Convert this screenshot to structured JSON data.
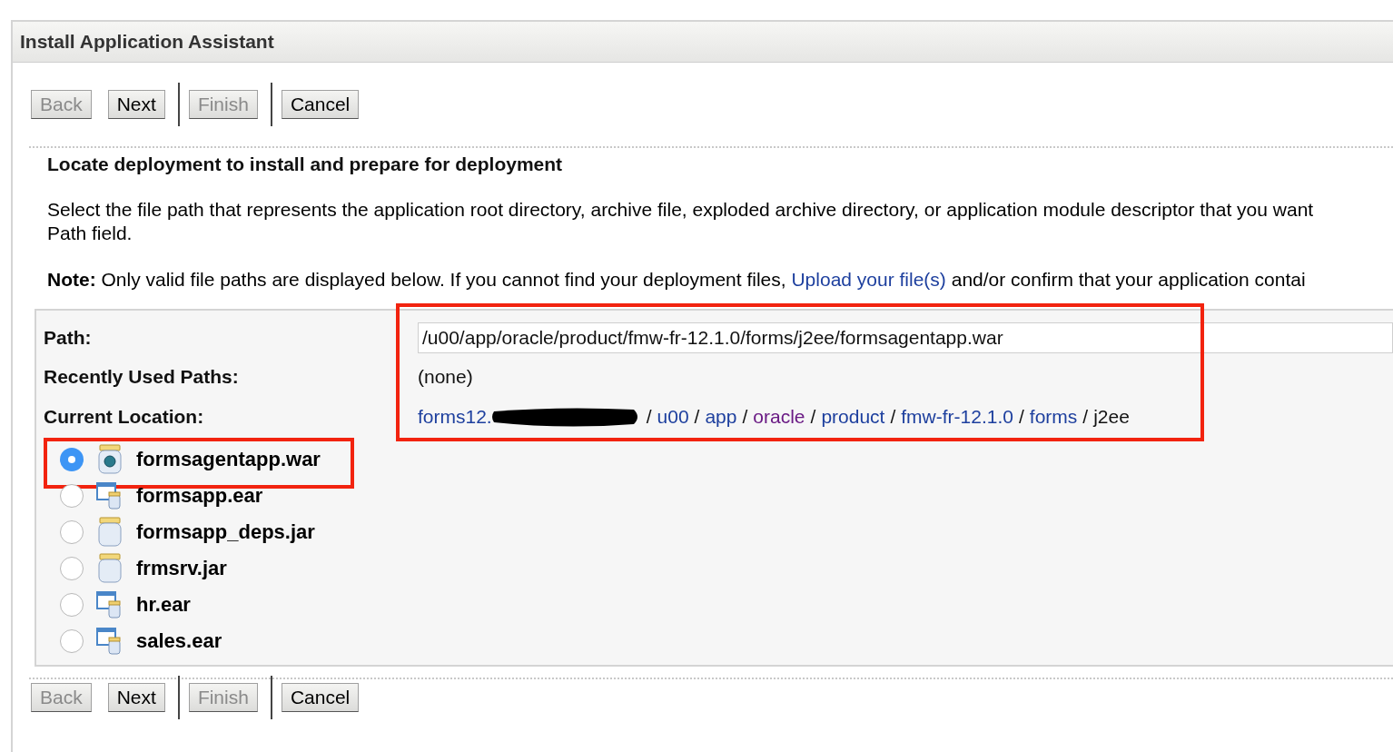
{
  "assistant": {
    "title": "Install Application Assistant"
  },
  "top_buttons": [
    {
      "label": "Back",
      "disabled": true,
      "separator_before": false
    },
    {
      "label": "Next",
      "disabled": false,
      "separator_before": false
    },
    {
      "label": "Finish",
      "disabled": true,
      "separator_before": true
    },
    {
      "label": "Cancel",
      "disabled": false,
      "separator_before": true
    }
  ],
  "heading": "Locate deployment to install and prepare for deployment",
  "description_lines": [
    "Select the file path that represents the application root directory, archive file, exploded archive directory, or application module descriptor that you want",
    "Path field."
  ],
  "note": {
    "label": "Note:",
    "text_before": "Only valid file paths are displayed below. If you cannot find your deployment files,",
    "link": "Upload your file(s)",
    "text_after": "and/or confirm that your application contai"
  },
  "location_panel": {
    "highlighted": true,
    "path_label": "Path:",
    "path_value": "/u00/app/oracle/product/fmw-fr-12.1.0/forms/j2ee/formsagentapp.war",
    "recent_label": "Recently Used Paths:",
    "recent_value": "(none)",
    "current_label": "Current Location:",
    "segments": [
      {
        "kind": "link",
        "text": "forms12."
      },
      {
        "kind": "redacted"
      },
      {
        "kind": "separator",
        "text": "/"
      },
      {
        "kind": "link",
        "text": "u00"
      },
      {
        "kind": "separator",
        "text": "/"
      },
      {
        "kind": "link",
        "text": "app"
      },
      {
        "kind": "separator",
        "text": "/"
      },
      {
        "kind": "visited",
        "text": "oracle"
      },
      {
        "kind": "separator",
        "text": "/"
      },
      {
        "kind": "link",
        "text": "product"
      },
      {
        "kind": "separator",
        "text": "/"
      },
      {
        "kind": "link",
        "text": "fmw-fr-12.1.0"
      },
      {
        "kind": "separator",
        "text": "/"
      },
      {
        "kind": "link",
        "text": "forms"
      },
      {
        "kind": "separator",
        "text": "/"
      },
      {
        "kind": "current",
        "text": "j2ee"
      }
    ]
  },
  "files": [
    {
      "name": "formsagentapp.war",
      "kind": "war",
      "selected": true,
      "highlighted": true
    },
    {
      "name": "formsapp.ear",
      "kind": "ear",
      "selected": false,
      "highlighted": false
    },
    {
      "name": "formsapp_deps.jar",
      "kind": "jar",
      "selected": false,
      "highlighted": false
    },
    {
      "name": "frmsrv.jar",
      "kind": "jar",
      "selected": false,
      "highlighted": false
    },
    {
      "name": "hr.ear",
      "kind": "ear",
      "selected": false,
      "highlighted": false
    },
    {
      "name": "sales.ear",
      "kind": "ear",
      "selected": false,
      "highlighted": false
    }
  ],
  "bottom_buttons": [
    {
      "label": "Back",
      "disabled": true,
      "separator_before": false
    },
    {
      "label": "Next",
      "disabled": false,
      "separator_before": false
    },
    {
      "label": "Finish",
      "disabled": true,
      "separator_before": true
    },
    {
      "label": "Cancel",
      "disabled": false,
      "separator_before": true
    }
  ]
}
